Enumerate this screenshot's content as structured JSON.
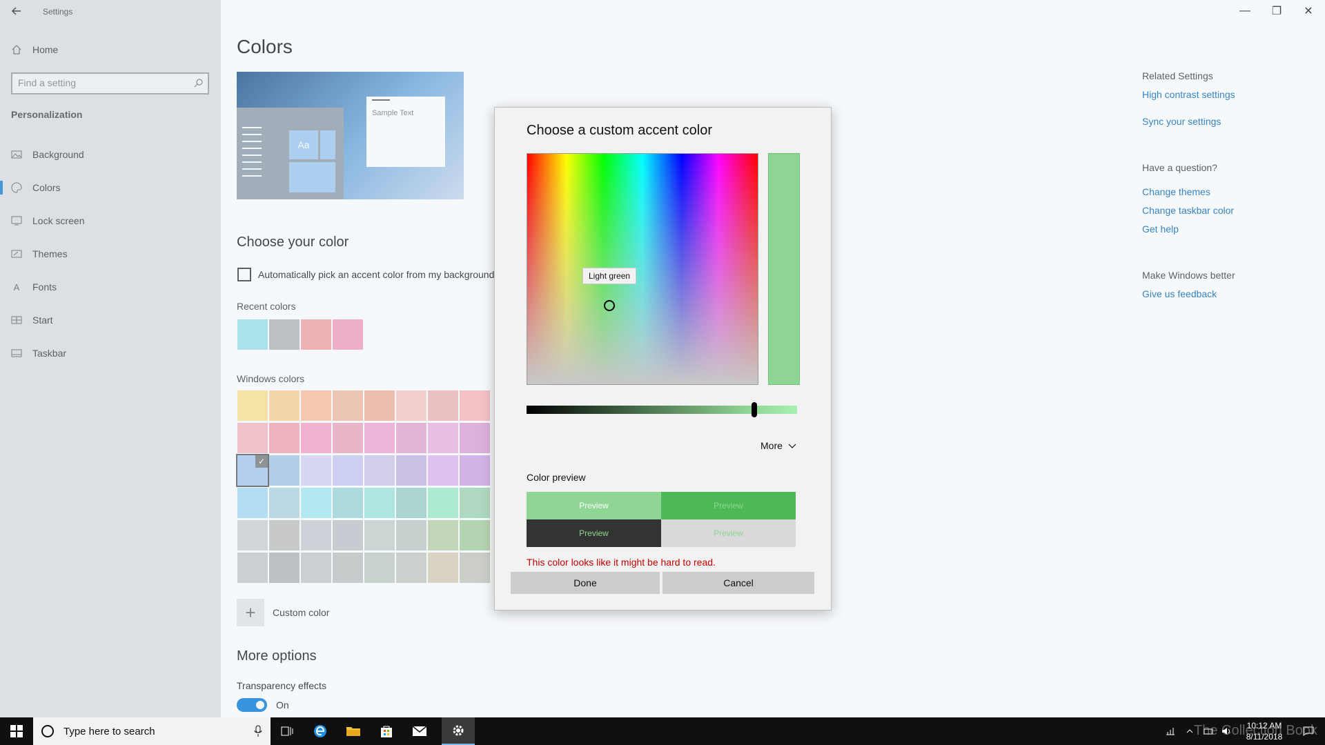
{
  "window": {
    "title": "Settings",
    "controls": {
      "minimize": "—",
      "restore": "❐",
      "close": "✕"
    }
  },
  "sidebar": {
    "home_label": "Home",
    "search_placeholder": "Find a setting",
    "section_title": "Personalization",
    "items": [
      {
        "label": "Background",
        "icon": "picture-icon"
      },
      {
        "label": "Colors",
        "icon": "palette-icon",
        "active": true
      },
      {
        "label": "Lock screen",
        "icon": "lock-screen-icon"
      },
      {
        "label": "Themes",
        "icon": "brush-icon"
      },
      {
        "label": "Fonts",
        "icon": "font-icon"
      },
      {
        "label": "Start",
        "icon": "start-icon"
      },
      {
        "label": "Taskbar",
        "icon": "taskbar-icon"
      }
    ]
  },
  "main": {
    "title": "Colors",
    "preview": {
      "sample_text": "Sample Text",
      "tile_text": "Aa"
    },
    "choose_heading": "Choose your color",
    "auto_pick_label": "Automatically pick an accent color from my background",
    "recent_label": "Recent colors",
    "recent_colors": [
      "#98e1e8",
      "#b3b3b3",
      "#f4a0a3",
      "#f49bbe"
    ],
    "windows_label": "Windows colors",
    "windows_colors": [
      [
        "#fde28f",
        "#fdd090",
        "#fcbc98",
        "#f1b8a0",
        "#f2b098",
        "#fac8c5",
        "#f1b3b5",
        "#fdb5b8"
      ],
      [
        "#f8b4bd",
        "#f7a2ac",
        "#f7a1c5",
        "#eea4bd",
        "#f5a5d6",
        "#e9a5d2",
        "#ebb0e0",
        "#dc9fd6"
      ],
      [
        "#a7c8ee",
        "#a4c6e7",
        "#d4d3f2",
        "#c7c7f1",
        "#d0c6ea",
        "#c4b4e0",
        "#e1b4ee",
        "#d0a0e2"
      ],
      [
        "#a6daf0",
        "#b0d3e0",
        "#a5eaf1",
        "#9fd4da",
        "#9fe4d8",
        "#9dcfc6",
        "#9dedc4",
        "#a1d4b0"
      ],
      [
        "#cfcfcf",
        "#c2c0bc",
        "#c9cbd1",
        "#c0c3c8",
        "#c6d1cb",
        "#bfc9c4",
        "#bdd0a6",
        "#a7cc9b"
      ],
      [
        "#c8c8c8",
        "#b5b5b5",
        "#c4c8c8",
        "#bfc3c1",
        "#c3ccc2",
        "#c5c8c0",
        "#d7cdb5",
        "#c6c5bd"
      ]
    ],
    "custom_color_label": "Custom color",
    "more_options": "More options",
    "transparency_label": "Transparency effects",
    "transparency_value": "On"
  },
  "related": {
    "heading": "Related Settings",
    "links": [
      "High contrast settings",
      "Sync your settings"
    ],
    "question_heading": "Have a question?",
    "question_links": [
      "Change themes",
      "Change taskbar color",
      "Get help"
    ],
    "better_heading": "Make Windows better",
    "feedback_link": "Give us feedback"
  },
  "dialog": {
    "title": "Choose a custom accent color",
    "tooltip": "Light green",
    "selected_color": "#8fd694",
    "value_slider_level": 0.86,
    "more_label": "More",
    "color_preview_label": "Color preview",
    "previews": [
      {
        "text": "Preview",
        "bg": "#8fd694",
        "fg": "#ffffff"
      },
      {
        "text": "Preview",
        "bg": "#4cb856",
        "fg": "#8fd694"
      },
      {
        "text": "Preview",
        "bg": "#333333",
        "fg": "#8fd694"
      },
      {
        "text": "Preview",
        "bg": "#d9d9d9",
        "fg": "#8fd694"
      }
    ],
    "warning": "This color looks like it might be hard to read.",
    "done_label": "Done",
    "cancel_label": "Cancel"
  },
  "taskbar": {
    "search_placeholder": "Type here to search",
    "time": "10:12 AM",
    "date": "8/11/2018",
    "watermark": "The Collection Book"
  }
}
